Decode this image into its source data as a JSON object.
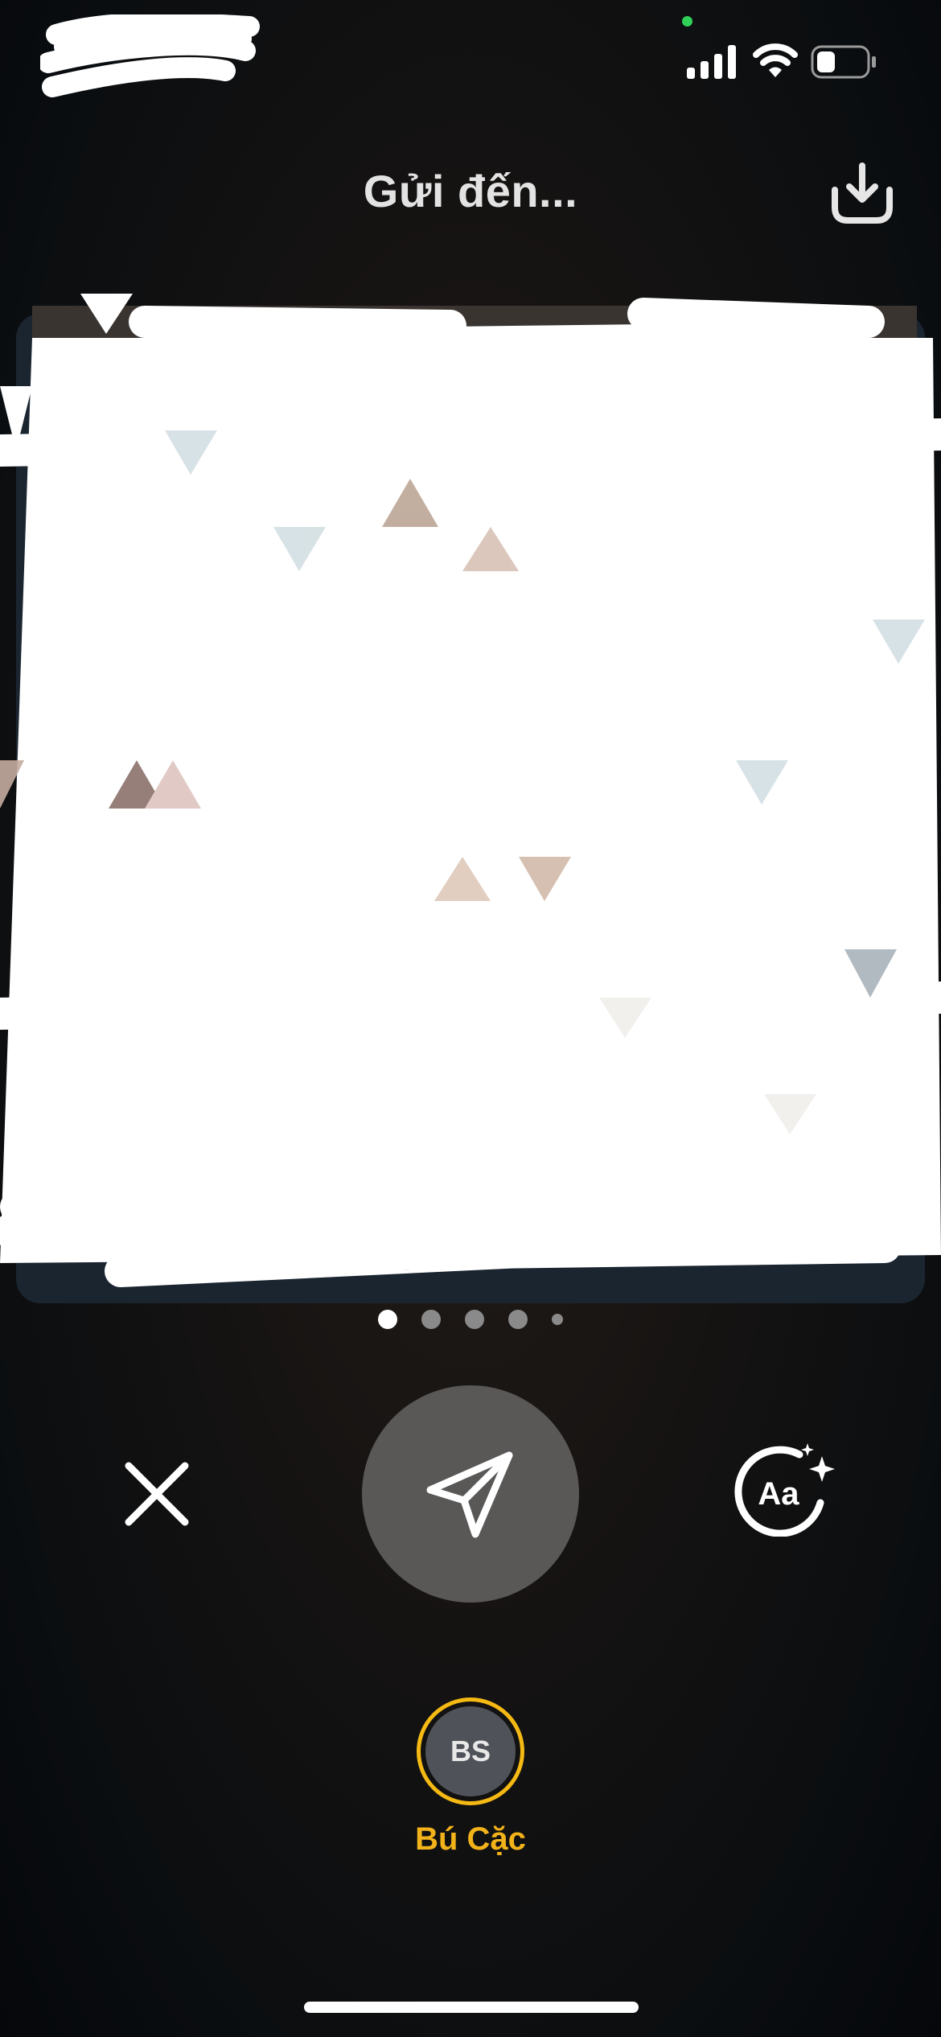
{
  "status_bar": {
    "signal_icon": "cellular-signal-icon",
    "wifi_icon": "wifi-icon",
    "battery_icon": "battery-icon",
    "privacy_indicator_color": "#30d158"
  },
  "header": {
    "title": "Gửi đến...",
    "download_icon": "download-icon"
  },
  "media": {
    "pages_count": 5,
    "active_page": 1
  },
  "controls": {
    "close_icon": "close-icon",
    "send_icon": "send-icon",
    "text_style_icon": "text-effects-icon"
  },
  "recipient": {
    "initials": "BS",
    "name": "Bú Cặc",
    "ring_color": "#f5b914"
  }
}
